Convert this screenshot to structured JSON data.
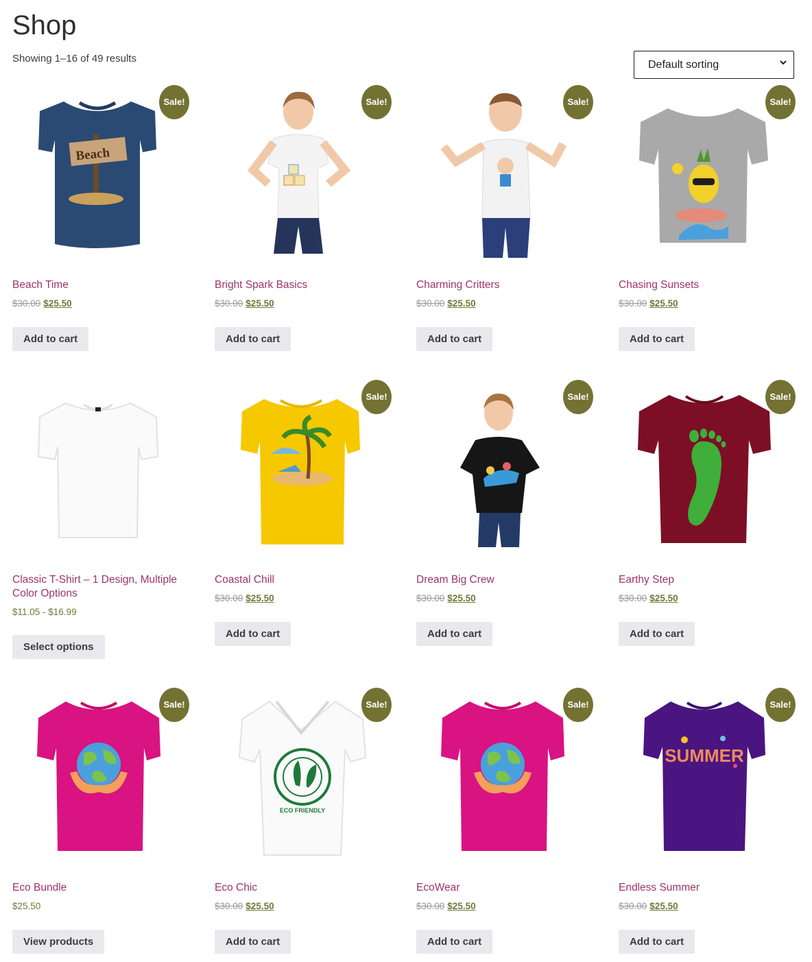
{
  "page": {
    "title": "Shop",
    "result_count": "Showing 1–16 of 49 results"
  },
  "sorting": {
    "selected": "Default sorting"
  },
  "sale_badge": "Sale!",
  "colors": {
    "accent": "#9e3367",
    "sale_badge": "#737233",
    "price": "#6d7a38",
    "button_bg": "#e9e9ed"
  },
  "products": [
    {
      "title": "Beach Time",
      "old_price": "$30.00",
      "price": "$25.50",
      "button": "Add to cart",
      "sale": true,
      "image": "navy t-shirt with beach sign"
    },
    {
      "title": "Bright Spark Basics",
      "old_price": "$30.00",
      "price": "$25.50",
      "button": "Add to cart",
      "sale": true,
      "image": "girl in white t-shirt with ABC blocks"
    },
    {
      "title": "Charming Critters",
      "old_price": "$30.00",
      "price": "$25.50",
      "button": "Add to cart",
      "sale": true,
      "image": "boy in white t-shirt with cartoon kid"
    },
    {
      "title": "Chasing Sunsets",
      "old_price": "$30.00",
      "price": "$25.50",
      "button": "Add to cart",
      "sale": true,
      "image": "grey t-shirt with surfing pineapple"
    },
    {
      "title": "Classic T-Shirt – 1 Design, Multiple Color Options",
      "price_range": "$11.05 - $16.99",
      "button": "Select options",
      "sale": false,
      "image": "plain white t-shirt"
    },
    {
      "title": "Coastal Chill",
      "old_price": "$30.00",
      "price": "$25.50",
      "button": "Add to cart",
      "sale": true,
      "image": "yellow t-shirt with palm tree"
    },
    {
      "title": "Dream Big Crew",
      "old_price": "$30.00",
      "price": "$25.50",
      "button": "Add to cart",
      "sale": true,
      "image": "girl in black t-shirt"
    },
    {
      "title": "Earthy Step",
      "old_price": "$30.00",
      "price": "$25.50",
      "button": "Add to cart",
      "sale": true,
      "image": "maroon t-shirt with green footprint"
    },
    {
      "title": "Eco Bundle",
      "plain_price": "$25.50",
      "button": "View products",
      "sale": true,
      "image": "magenta t-shirt with earth in hands"
    },
    {
      "title": "Eco Chic",
      "old_price": "$30.00",
      "price": "$25.50",
      "button": "Add to cart",
      "sale": true,
      "image": "white v-neck with eco friendly stamp",
      "stamp_text": "ECO FRIENDLY"
    },
    {
      "title": "EcoWear",
      "old_price": "$30.00",
      "price": "$25.50",
      "button": "Add to cart",
      "sale": true,
      "image": "magenta t-shirt with earth in hands"
    },
    {
      "title": "Endless Summer",
      "old_price": "$30.00",
      "price": "$25.50",
      "button": "Add to cart",
      "sale": true,
      "image": "purple t-shirt with summer lettering",
      "print_text": "SUMMER"
    }
  ]
}
